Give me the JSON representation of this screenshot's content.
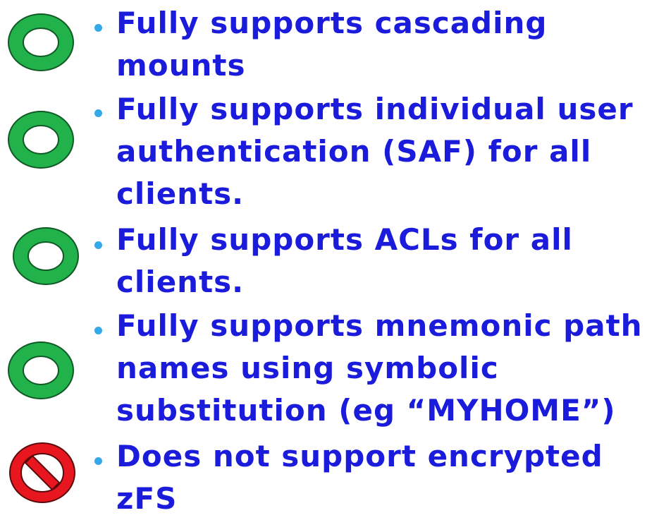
{
  "colors": {
    "text": "#1b1bdc",
    "bullet": "#36a8e8",
    "supported_fill": "#22b24c",
    "unsupported_fill": "#e8161f"
  },
  "items": [
    {
      "status": "supported",
      "icon": "green-ring-icon",
      "text": "Fully supports cascading\nmounts"
    },
    {
      "status": "supported",
      "icon": "green-ring-icon",
      "text": "Fully supports individual user\nauthentication (SAF) for all\nclients."
    },
    {
      "status": "supported",
      "icon": "green-ring-icon",
      "text": "Fully supports ACLs for all\nclients."
    },
    {
      "status": "supported",
      "icon": "green-ring-icon",
      "text": "Fully supports mnemonic path\nnames using symbolic\nsubstitution (eg “MYHOME”)"
    },
    {
      "status": "unsupported",
      "icon": "no-symbol-icon",
      "text": "Does not support encrypted\nzFS"
    }
  ]
}
